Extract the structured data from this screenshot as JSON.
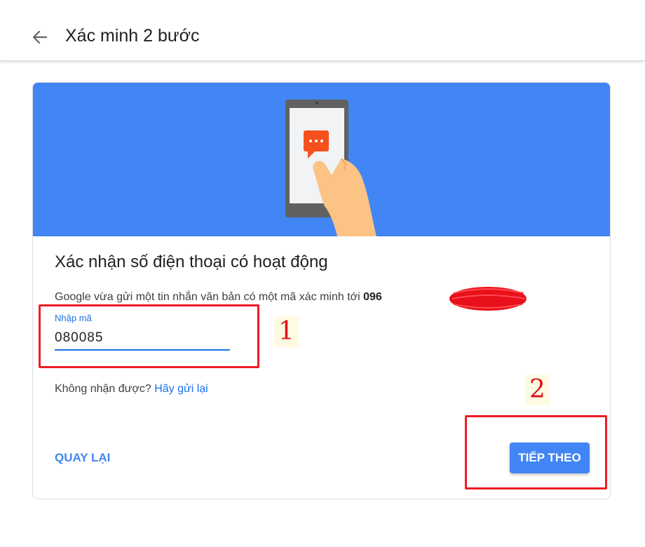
{
  "header": {
    "back_icon": "arrow-back-icon",
    "title": "Xác minh 2 bước"
  },
  "card": {
    "illustration": "phone-message-illustration",
    "colors": {
      "banner": "#4285f4",
      "phone": "#616161",
      "message_bubble": "#f4511e",
      "hand": "#fbc384"
    },
    "heading": "Xác nhận số điện thoại có hoạt động",
    "info_text": "Google vừa gửi một tin nhắn văn bản có một mã xác minh tới ",
    "phone_prefix": "096",
    "code_field": {
      "label": "Nhập mã",
      "value": "080085"
    },
    "resend_prompt": "Không nhận được? ",
    "resend_link": "Hãy gửi lại",
    "back_label": "QUAY LẠI",
    "next_label": "TIẾP THEO"
  },
  "annotations": {
    "color": "#ee1c25",
    "marker_1": "1",
    "marker_2": "2"
  }
}
